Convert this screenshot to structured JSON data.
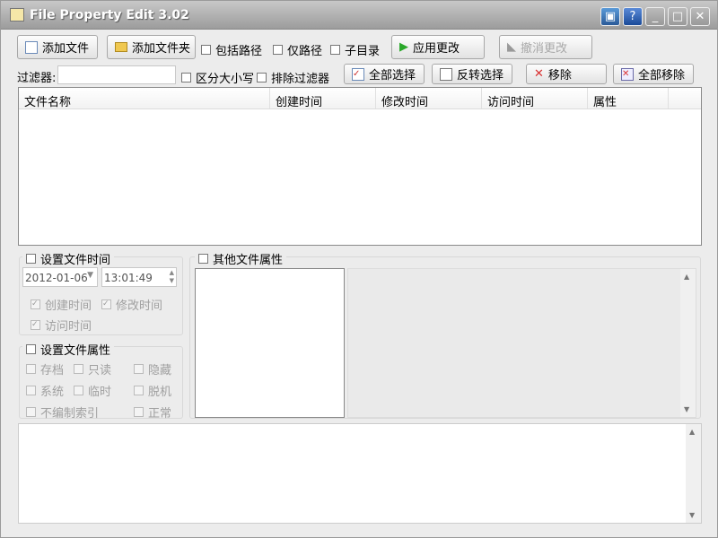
{
  "window": {
    "title": "File Property Edit  3.02",
    "controls": [
      "cube-icon",
      "help-icon",
      "minimize-icon",
      "maximize-icon",
      "close-icon"
    ]
  },
  "toolbar": {
    "add_file": "添加文件",
    "add_folder": "添加文件夹",
    "include_path": "包括路径",
    "path_only": "仅路径",
    "subdir": "子目录",
    "apply": "应用更改",
    "undo": "撤消更改"
  },
  "filterbar": {
    "label": "过滤器:",
    "value": "",
    "case_sensitive": "区分大小写",
    "exclude_filter": "排除过滤器",
    "select_all": "全部选择",
    "invert_select": "反转选择",
    "remove": "移除",
    "remove_all": "全部移除"
  },
  "list": {
    "columns": [
      "文件名称",
      "创建时间",
      "修改时间",
      "访问时间",
      "属性"
    ],
    "rows": []
  },
  "file_time": {
    "title": "设置文件时间",
    "date": "2012-01-06",
    "time": "13:01:49",
    "created": "创建时间",
    "modified": "修改时间",
    "accessed": "访问时间"
  },
  "file_attr": {
    "title": "设置文件属性",
    "items": [
      "存档",
      "只读",
      "隐藏",
      "系统",
      "临时",
      "脱机",
      "不编制索引",
      "正常"
    ]
  },
  "other_attr": {
    "title": "其他文件属性"
  },
  "colors": {
    "apply_icon": "#2aa82a",
    "remove_icon": "#d83030"
  }
}
